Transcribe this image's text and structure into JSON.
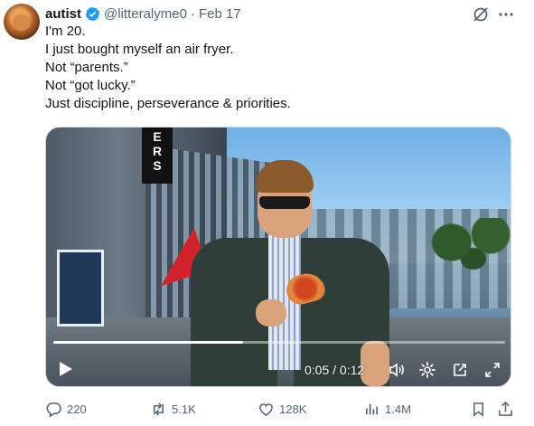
{
  "tweet": {
    "author_name": "autist",
    "handle": "@litteralyme0",
    "separator": "·",
    "date": "Feb 17",
    "text_lines": [
      "I'm 20.",
      "I just bought myself an air fryer.",
      "Not “parents.”",
      "Not “got lucky.”",
      "Just discipline, perseverance & priorities."
    ]
  },
  "icons": {
    "verified": "verified-badge-icon",
    "grok": "grok-icon",
    "more": "more-icon"
  },
  "media": {
    "sign_text": "ERS",
    "time_display": "0:05 / 0:12",
    "progress": 0.42,
    "accent_colors": {
      "umbrella": "#d2232a",
      "jacket": "#2f3e39"
    }
  },
  "actions": {
    "reply_count": "220",
    "repost_count": "5.1K",
    "like_count": "128K",
    "view_count": "1.4M"
  },
  "colors": {
    "verified": "#1d9bf0",
    "secondary_text": "#536471",
    "primary_text": "#0f1419"
  }
}
